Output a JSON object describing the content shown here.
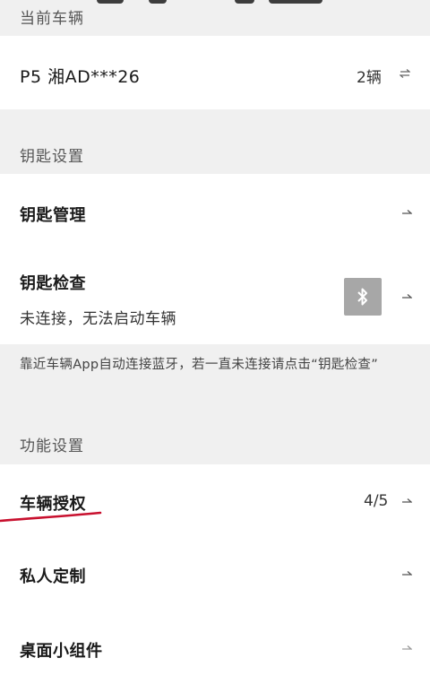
{
  "current_vehicle": {
    "header": "当前车辆",
    "plate": "P5 湘AD***26",
    "count": "2辆"
  },
  "key_settings": {
    "header": "钥匙设置",
    "manage_label": "钥匙管理",
    "check_label": "钥匙检查",
    "check_status": "未连接，无法启动车辆",
    "hint": "靠近车辆App自动连接蓝牙，若一直未连接请点击“钥匙检查”"
  },
  "function_settings": {
    "header": "功能设置",
    "auth_label": "车辆授权",
    "auth_value": "4/5",
    "custom_label": "私人定制",
    "widget_label": "桌面小组件"
  },
  "colors": {
    "background": "#f0f0f0",
    "card": "#ffffff",
    "bluetooth_button": "#a7a7a7",
    "underline_annotation": "#c8102e"
  },
  "icons": {
    "swap": "swap-icon",
    "arrow": "arrow-right-icon",
    "bluetooth": "bluetooth-icon"
  }
}
